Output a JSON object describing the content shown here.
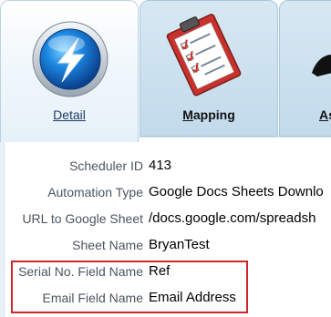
{
  "tabs": [
    {
      "label": "Detail",
      "icon": "lightning-bolt-icon",
      "selected": true
    },
    {
      "label": "Mapping",
      "icon": "clipboard-checklist-icon",
      "selected": false
    },
    {
      "label": "As",
      "icon": "person-icon",
      "selected": false
    }
  ],
  "form": {
    "fields": [
      {
        "label": "Scheduler ID",
        "value": "413"
      },
      {
        "label": "Automation Type",
        "value": "Google Docs Sheets Downlo"
      },
      {
        "label": "URL to Google Sheet",
        "value": "/docs.google.com/spreadsh"
      },
      {
        "label": "Sheet Name",
        "value": "BryanTest"
      },
      {
        "label": "Serial No. Field Name",
        "value": "Ref"
      },
      {
        "label": "Email Field Name",
        "value": "Email Address"
      }
    ]
  },
  "colors": {
    "highlight_border": "#d0262b",
    "tab_text": "#1f3a6a",
    "label_text": "#4a5560"
  }
}
